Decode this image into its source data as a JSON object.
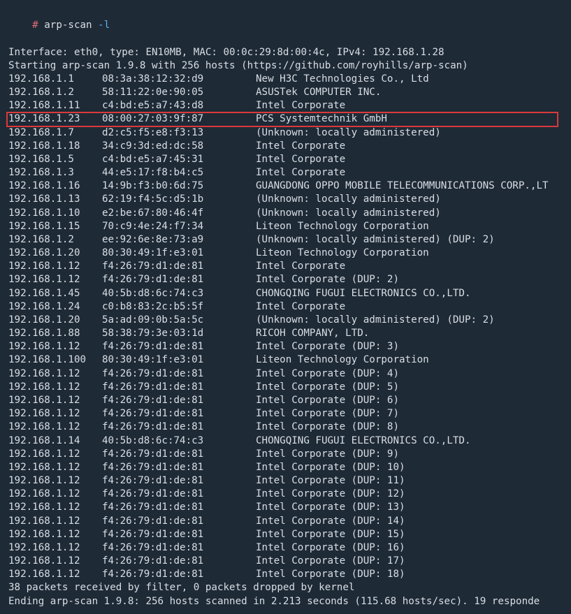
{
  "prompt": {
    "hash": "#",
    "command": "arp-scan",
    "flag": "-l"
  },
  "header": {
    "iface_line": "Interface: eth0, type: EN10MB, MAC: 00:0c:29:8d:00:4c, IPv4: 192.168.1.28",
    "start_line": "Starting arp-scan 1.9.8 with 256 hosts (https://github.com/royhills/arp-scan)"
  },
  "highlight_index": 3,
  "rows": [
    {
      "ip": "192.168.1.1",
      "mac": "08:3a:38:12:32:d9",
      "vendor": "New H3C Technologies Co., Ltd"
    },
    {
      "ip": "192.168.1.2",
      "mac": "58:11:22:0e:90:05",
      "vendor": "ASUSTek COMPUTER INC."
    },
    {
      "ip": "192.168.1.11",
      "mac": "c4:bd:e5:a7:43:d8",
      "vendor": "Intel Corporate"
    },
    {
      "ip": "192.168.1.23",
      "mac": "08:00:27:03:9f:87",
      "vendor": "PCS Systemtechnik GmbH"
    },
    {
      "ip": "192.168.1.7",
      "mac": "d2:c5:f5:e8:f3:13",
      "vendor": "(Unknown: locally administered)"
    },
    {
      "ip": "192.168.1.18",
      "mac": "34:c9:3d:ed:dc:58",
      "vendor": "Intel Corporate"
    },
    {
      "ip": "192.168.1.5",
      "mac": "c4:bd:e5:a7:45:31",
      "vendor": "Intel Corporate"
    },
    {
      "ip": "192.168.1.3",
      "mac": "44:e5:17:f8:b4:c5",
      "vendor": "Intel Corporate"
    },
    {
      "ip": "192.168.1.16",
      "mac": "14:9b:f3:b0:6d:75",
      "vendor": "GUANGDONG OPPO MOBILE TELECOMMUNICATIONS CORP.,LT"
    },
    {
      "ip": "192.168.1.13",
      "mac": "62:19:f4:5c:d5:1b",
      "vendor": "(Unknown: locally administered)"
    },
    {
      "ip": "192.168.1.10",
      "mac": "e2:be:67:80:46:4f",
      "vendor": "(Unknown: locally administered)"
    },
    {
      "ip": "192.168.1.15",
      "mac": "70:c9:4e:24:f7:34",
      "vendor": "Liteon Technology Corporation"
    },
    {
      "ip": "192.168.1.2",
      "mac": "ee:92:6e:8e:73:a9",
      "vendor": "(Unknown: locally administered) (DUP: 2)"
    },
    {
      "ip": "192.168.1.20",
      "mac": "80:30:49:1f:e3:01",
      "vendor": "Liteon Technology Corporation"
    },
    {
      "ip": "192.168.1.12",
      "mac": "f4:26:79:d1:de:81",
      "vendor": "Intel Corporate"
    },
    {
      "ip": "192.168.1.12",
      "mac": "f4:26:79:d1:de:81",
      "vendor": "Intel Corporate (DUP: 2)"
    },
    {
      "ip": "192.168.1.45",
      "mac": "40:5b:d8:6c:74:c3",
      "vendor": "CHONGQING FUGUI ELECTRONICS CO.,LTD."
    },
    {
      "ip": "192.168.1.24",
      "mac": "c0:b8:83:2c:b5:5f",
      "vendor": "Intel Corporate"
    },
    {
      "ip": "192.168.1.20",
      "mac": "5a:ad:09:0b:5a:5c",
      "vendor": "(Unknown: locally administered) (DUP: 2)"
    },
    {
      "ip": "192.168.1.88",
      "mac": "58:38:79:3e:03:1d",
      "vendor": "RICOH COMPANY, LTD."
    },
    {
      "ip": "192.168.1.12",
      "mac": "f4:26:79:d1:de:81",
      "vendor": "Intel Corporate (DUP: 3)"
    },
    {
      "ip": "192.168.1.100",
      "mac": "80:30:49:1f:e3:01",
      "vendor": "Liteon Technology Corporation"
    },
    {
      "ip": "192.168.1.12",
      "mac": "f4:26:79:d1:de:81",
      "vendor": "Intel Corporate (DUP: 4)"
    },
    {
      "ip": "192.168.1.12",
      "mac": "f4:26:79:d1:de:81",
      "vendor": "Intel Corporate (DUP: 5)"
    },
    {
      "ip": "192.168.1.12",
      "mac": "f4:26:79:d1:de:81",
      "vendor": "Intel Corporate (DUP: 6)"
    },
    {
      "ip": "192.168.1.12",
      "mac": "f4:26:79:d1:de:81",
      "vendor": "Intel Corporate (DUP: 7)"
    },
    {
      "ip": "192.168.1.12",
      "mac": "f4:26:79:d1:de:81",
      "vendor": "Intel Corporate (DUP: 8)"
    },
    {
      "ip": "192.168.1.14",
      "mac": "40:5b:d8:6c:74:c3",
      "vendor": "CHONGQING FUGUI ELECTRONICS CO.,LTD."
    },
    {
      "ip": "192.168.1.12",
      "mac": "f4:26:79:d1:de:81",
      "vendor": "Intel Corporate (DUP: 9)"
    },
    {
      "ip": "192.168.1.12",
      "mac": "f4:26:79:d1:de:81",
      "vendor": "Intel Corporate (DUP: 10)"
    },
    {
      "ip": "192.168.1.12",
      "mac": "f4:26:79:d1:de:81",
      "vendor": "Intel Corporate (DUP: 11)"
    },
    {
      "ip": "192.168.1.12",
      "mac": "f4:26:79:d1:de:81",
      "vendor": "Intel Corporate (DUP: 12)"
    },
    {
      "ip": "192.168.1.12",
      "mac": "f4:26:79:d1:de:81",
      "vendor": "Intel Corporate (DUP: 13)"
    },
    {
      "ip": "192.168.1.12",
      "mac": "f4:26:79:d1:de:81",
      "vendor": "Intel Corporate (DUP: 14)"
    },
    {
      "ip": "192.168.1.12",
      "mac": "f4:26:79:d1:de:81",
      "vendor": "Intel Corporate (DUP: 15)"
    },
    {
      "ip": "192.168.1.12",
      "mac": "f4:26:79:d1:de:81",
      "vendor": "Intel Corporate (DUP: 16)"
    },
    {
      "ip": "192.168.1.12",
      "mac": "f4:26:79:d1:de:81",
      "vendor": "Intel Corporate (DUP: 17)"
    },
    {
      "ip": "192.168.1.12",
      "mac": "f4:26:79:d1:de:81",
      "vendor": "Intel Corporate (DUP: 18)"
    }
  ],
  "footer": {
    "blank": "",
    "packets_line": "38 packets received by filter, 0 packets dropped by kernel",
    "ending_line": "Ending arp-scan 1.9.8: 256 hosts scanned in 2.213 seconds (115.68 hosts/sec). 19 responde"
  }
}
